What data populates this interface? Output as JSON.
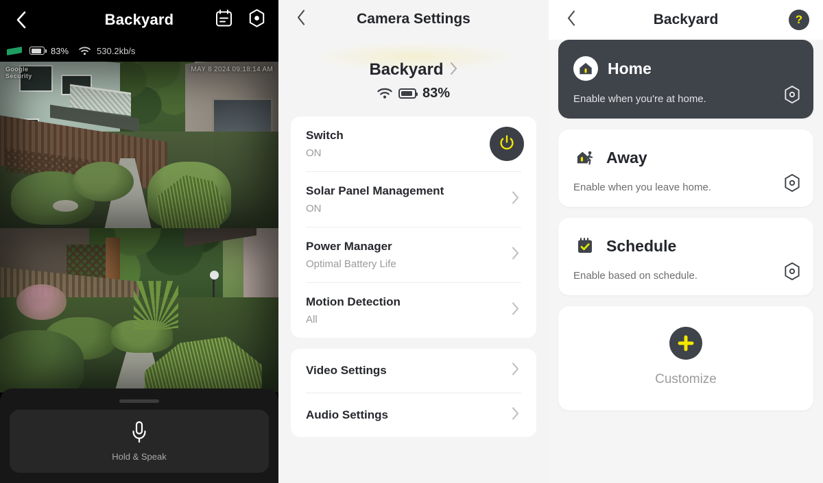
{
  "live": {
    "title": "Backyard",
    "back_icon": "back-chevron-icon",
    "events_icon": "calendar-events-icon",
    "settings_icon": "hex-settings-icon",
    "status": {
      "battery_pct": "83%",
      "network_rate": "530.2kb/s",
      "signal_icon": "solar-signal-icon",
      "battery_icon": "battery-icon",
      "wifi_icon": "wifi-icon"
    },
    "feed_watermark": "Google\nSecurity",
    "feed_timestamp": "MAY 8 2024 09:18:14 AM",
    "intercom": {
      "mic_icon": "microphone-icon",
      "label": "Hold & Speak"
    }
  },
  "settings": {
    "title": "Camera Settings",
    "back_icon": "back-chevron-icon",
    "device": {
      "name": "Backyard",
      "chevron_icon": "chevron-right-icon",
      "wifi_icon": "wifi-icon",
      "battery_icon": "battery-icon",
      "battery_pct": "83%"
    },
    "group_one": [
      {
        "label": "Switch",
        "value": "ON",
        "control": "power-toggle-button",
        "control_icon": "power-icon"
      },
      {
        "label": "Solar Panel Management",
        "value": "ON",
        "control": "chevron",
        "control_icon": "chevron-right-icon"
      },
      {
        "label": "Power Manager",
        "value": "Optimal Battery Life",
        "control": "chevron",
        "control_icon": "chevron-right-icon"
      },
      {
        "label": "Motion Detection",
        "value": "All",
        "control": "chevron",
        "control_icon": "chevron-right-icon"
      }
    ],
    "group_two": [
      {
        "label": "Video Settings",
        "control": "chevron",
        "control_icon": "chevron-right-icon"
      },
      {
        "label": "Audio Settings",
        "control": "chevron",
        "control_icon": "chevron-right-icon"
      }
    ]
  },
  "modes": {
    "title": "Backyard",
    "back_icon": "back-chevron-icon",
    "help_icon": "help-question-icon",
    "help_label": "?",
    "cards": [
      {
        "title": "Home",
        "desc": "Enable when you're at home.",
        "icon": "home-house-icon",
        "gear_icon": "hex-settings-icon",
        "active": true
      },
      {
        "title": "Away",
        "desc": "Enable when you leave home.",
        "icon": "away-running-person-icon",
        "gear_icon": "hex-settings-icon",
        "active": false
      },
      {
        "title": "Schedule",
        "desc": "Enable based on schedule.",
        "icon": "calendar-check-icon",
        "gear_icon": "hex-settings-icon",
        "active": false
      }
    ],
    "customize": {
      "label": "Customize",
      "icon": "plus-icon"
    }
  },
  "colors": {
    "accent_yellow": "#f2e800",
    "dark_slate": "#3f434a",
    "page_bg": "#f4f4f4",
    "card_white": "#ffffff"
  }
}
